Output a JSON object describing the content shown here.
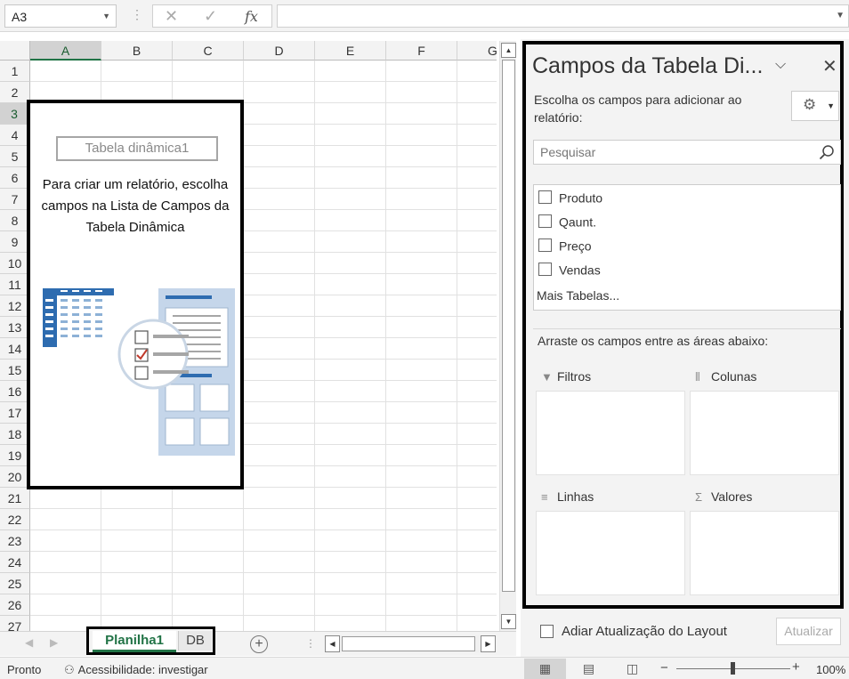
{
  "formula_bar": {
    "name_box": "A3",
    "fx_label": "fx",
    "formula": ""
  },
  "grid": {
    "columns": [
      "A",
      "B",
      "C",
      "D",
      "E",
      "F",
      "G"
    ],
    "rows": [
      "1",
      "2",
      "3",
      "4",
      "5",
      "6",
      "7",
      "8",
      "9",
      "10",
      "11",
      "12",
      "13",
      "14",
      "15",
      "16",
      "17",
      "18",
      "19",
      "20",
      "21",
      "22",
      "23",
      "24",
      "25",
      "26",
      "27"
    ],
    "selected_column": "A",
    "selected_row": "3"
  },
  "pivot_placeholder": {
    "name": "Tabela dinâmica1",
    "instructions": "Para criar um relatório, escolha campos na Lista de Campos da Tabela Dinâmica"
  },
  "sheets": {
    "tabs": [
      {
        "label": "Planilha1",
        "active": true
      },
      {
        "label": "DB",
        "active": false
      }
    ],
    "add_label": "+"
  },
  "field_pane": {
    "title": "Campos da Tabela Di...",
    "choose_text": "Escolha os campos para adicionar ao relatório:",
    "search_placeholder": "Pesquisar",
    "fields": [
      {
        "label": "Produto",
        "checked": false
      },
      {
        "label": "Qaunt.",
        "checked": false
      },
      {
        "label": "Preço",
        "checked": false
      },
      {
        "label": "Vendas",
        "checked": false
      }
    ],
    "more_tables": "Mais Tabelas...",
    "drag_text": "Arraste os campos entre as áreas abaixo:",
    "areas": {
      "filters": "Filtros",
      "columns": "Colunas",
      "rows": "Linhas",
      "values": "Valores"
    },
    "defer_label": "Adiar Atualização do Layout",
    "update_label": "Atualizar"
  },
  "status_bar": {
    "ready": "Pronto",
    "accessibility": "Acessibilidade: investigar",
    "zoom": "100%",
    "zoom_minus": "−",
    "zoom_plus": "+"
  },
  "colors": {
    "accent": "#217346",
    "pivot_border": "#000000"
  }
}
